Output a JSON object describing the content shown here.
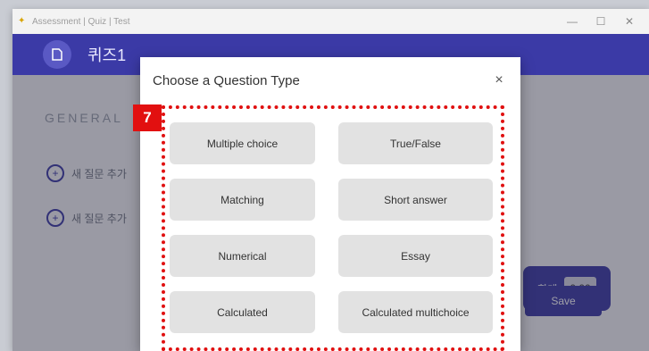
{
  "window": {
    "title": "Assessment | Quiz | Test",
    "minimize": "—",
    "maximize": "☐",
    "close": "✕"
  },
  "header": {
    "badge_icon": "document-icon",
    "quiz_title": "퀴즈1"
  },
  "sidebar": {
    "section": "GENERAL",
    "add_items": [
      {
        "label": "새 질문 추가"
      },
      {
        "label": "새 질문 추가"
      }
    ]
  },
  "total": {
    "label": "합계",
    "value": "0.00"
  },
  "save_label": "Save",
  "modal": {
    "title": "Choose a Question Type",
    "close": "×",
    "types": [
      "Multiple choice",
      "True/False",
      "Matching",
      "Short answer",
      "Numerical",
      "Essay",
      "Calculated",
      "Calculated multichoice"
    ]
  },
  "annotation": {
    "step": "7",
    "color": "#e01010"
  },
  "colors": {
    "brand": "#3b3aa6",
    "button_bg": "#e2e2e2"
  }
}
